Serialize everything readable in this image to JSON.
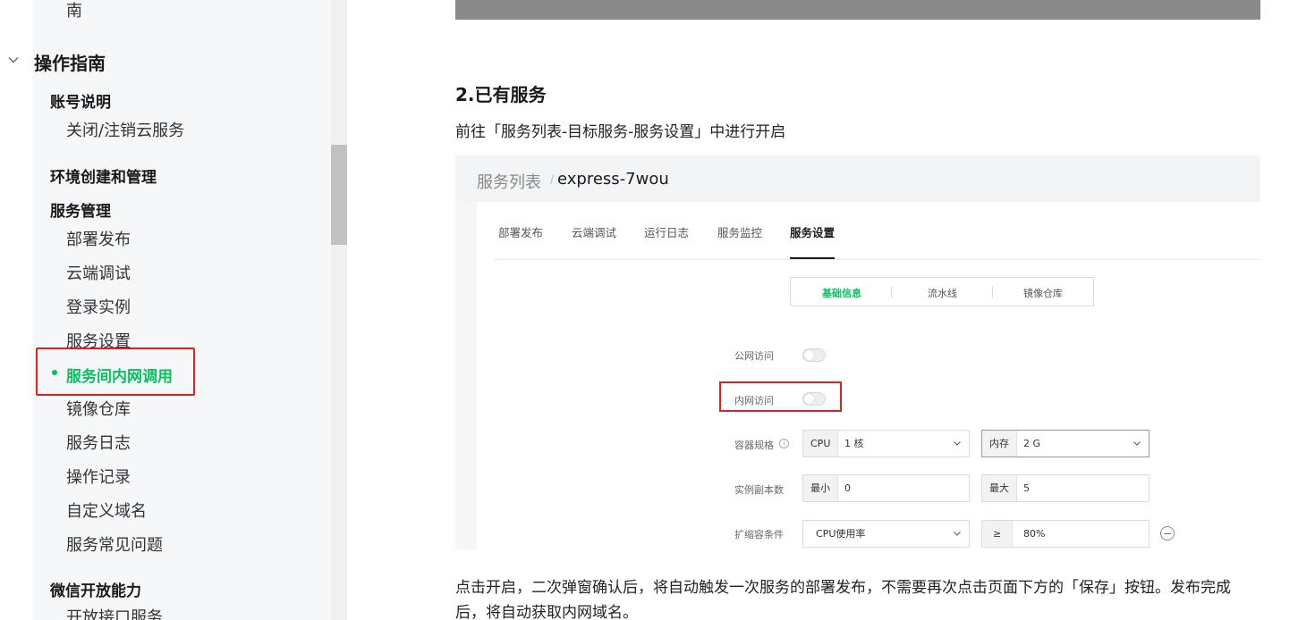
{
  "sidebar": {
    "top_fragment": "南",
    "group_title": "操作指南",
    "sections": {
      "account": "账号说明",
      "env": "环境创建和管理",
      "service": "服务管理",
      "wechat": "微信开放能力"
    },
    "links": {
      "close_service": "关闭/注销云服务",
      "deploy": "部署发布",
      "debug": "云端调试",
      "login_instance": "登录实例",
      "service_settings": "服务设置",
      "internal_call": "服务间内网调用",
      "image_repo": "镜像仓库",
      "service_log": "服务日志",
      "op_record": "操作记录",
      "custom_domain": "自定义域名",
      "faq": "服务常见问题",
      "open_api": "开放接口服务"
    }
  },
  "article": {
    "heading": "2.已有服务",
    "intro": "前往「服务列表-目标服务-服务设置」中进行开启",
    "outro": "点击开启，二次弹窗确认后，将自动触发一次服务的部署发布，不需要再次点击页面下方的「保存」按钮。发布完成后，将自动获取内网域名。"
  },
  "screenshot": {
    "breadcrumb_parent": "服务列表",
    "breadcrumb_sep": "/",
    "breadcrumb_current": "express-7wou",
    "tabs": [
      "部署发布",
      "云端调试",
      "运行日志",
      "服务监控",
      "服务设置"
    ],
    "active_tab": "服务设置",
    "segments": [
      "基础信息",
      "流水线",
      "镜像仓库"
    ],
    "active_segment": "基础信息",
    "public_access_label": "公网访问",
    "public_access_on": false,
    "internal_access_label": "内网访问",
    "internal_access_on": false,
    "container_spec_label": "容器规格",
    "cpu_prefix": "CPU",
    "cpu_value": "1 核",
    "mem_prefix": "内存",
    "mem_value": "2 G",
    "replicas_label": "实例副本数",
    "min_prefix": "最小",
    "min_value": "0",
    "max_prefix": "最大",
    "max_value": "5",
    "scale_label": "扩缩容条件",
    "scale_metric": "CPU使用率",
    "scale_op": "≥",
    "scale_threshold": "80%",
    "info_glyph": "i"
  },
  "colors": {
    "accent_green": "#07c160",
    "highlight_red": "#e02020"
  }
}
